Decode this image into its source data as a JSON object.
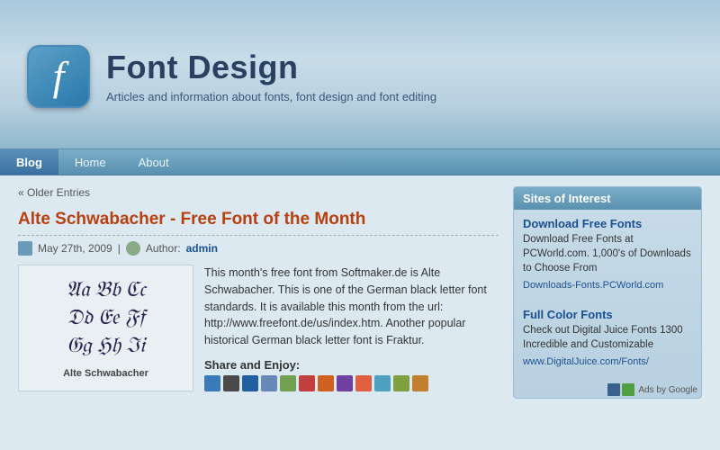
{
  "header": {
    "logo_letter": "f",
    "title": "Font Design",
    "subtitle": "Articles and information about fonts, font design and font editing"
  },
  "nav": {
    "items": [
      {
        "label": "Blog",
        "active": true
      },
      {
        "label": "Home",
        "active": false
      },
      {
        "label": "About",
        "active": false
      }
    ]
  },
  "main": {
    "older_entries_link": "« Older Entries",
    "post": {
      "title": "Alte Schwabacher - Free Font of the Month",
      "date": "May 27th, 2009",
      "author_label": "Author:",
      "author": "admin",
      "font_preview_lines": [
        "Aa Bb Cc",
        "Dd Ee Ff",
        "Gg Hh Ii"
      ],
      "font_preview_label": "Alte Schwabacher",
      "body": "This month's free font from Softmaker.de is Alte Schwabacher. This is one of the German black letter font standards. It is available this month from the url: http://www.freefont.de/us/index.htm.  Another popular historical German black letter font is Fraktur.",
      "share_label": "Share and Enjoy:"
    }
  },
  "sidebar": {
    "section_title": "Sites of Interest",
    "entries": [
      {
        "link_title": "Download Free Fonts",
        "description": "Download Free Fonts at PCWorld.com. 1,000's of Downloads to Choose From",
        "url": "Downloads-Fonts.PCWorld.com"
      },
      {
        "link_title": "Full Color Fonts",
        "description": "Check out Digital Juice Fonts 1300 Incredible and Customizable",
        "url": "www.DigitalJuice.com/Fonts/"
      }
    ],
    "ads_label": "Ads by Google"
  },
  "share_icon_colors": [
    "#3a7ab8",
    "#4a4a4a",
    "#2060a0",
    "#6888b8",
    "#70a050",
    "#c04040",
    "#d06020",
    "#7040a0",
    "#e06040",
    "#50a0c0",
    "#80a040",
    "#c08030"
  ]
}
